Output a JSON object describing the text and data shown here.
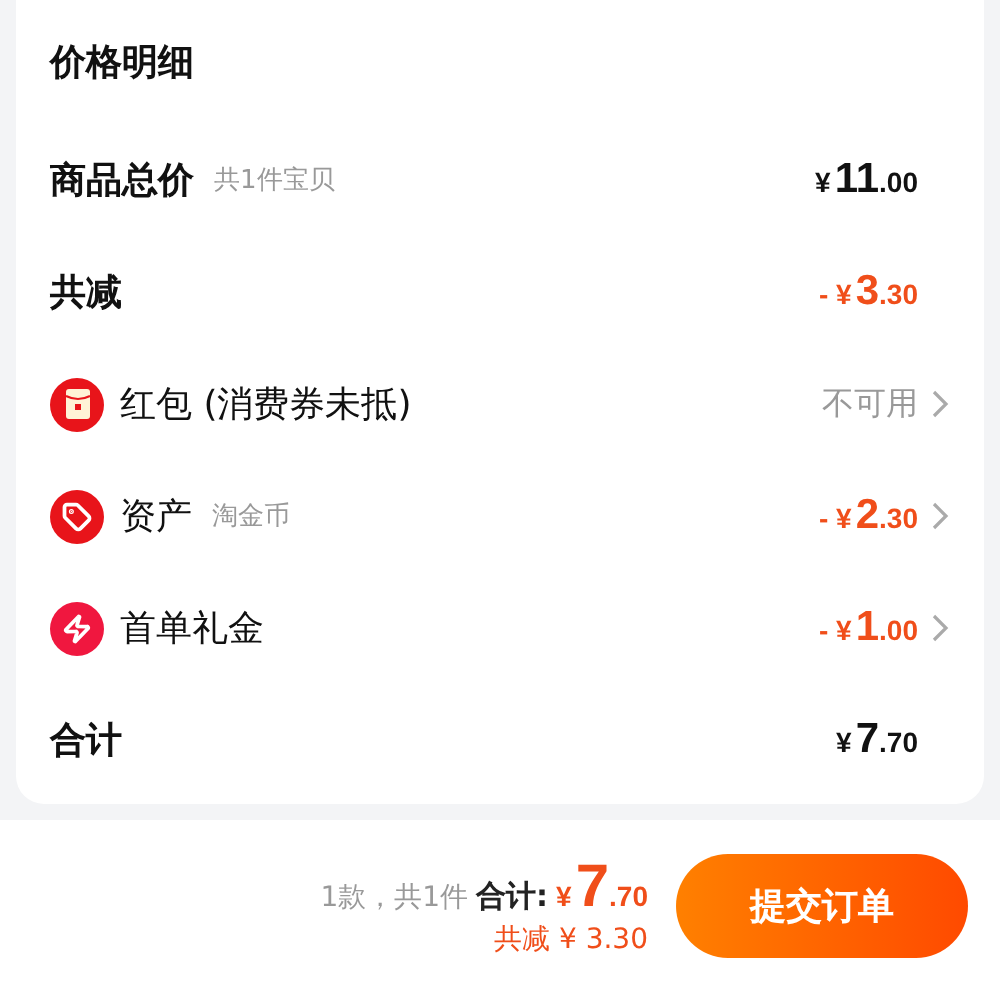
{
  "title": "价格明细",
  "rows": [
    {
      "kind": "summary",
      "label": "商品总价",
      "note": "共1件宝贝",
      "value": {
        "kind": "price",
        "sign": "¥",
        "integer": "11",
        "decimals": ".00"
      },
      "chevron": false
    },
    {
      "kind": "summary",
      "label": "共减",
      "value": {
        "kind": "deduction",
        "sign": "- ¥",
        "integer": "3",
        "decimals": ".30"
      },
      "chevron": false
    },
    {
      "kind": "packet",
      "label": "红包 (消费券未抵)",
      "value": {
        "kind": "text",
        "text": "不可用"
      },
      "chevron": true
    },
    {
      "kind": "asset",
      "label": "资产",
      "note": "淘金币",
      "value": {
        "kind": "deduction",
        "sign": "- ¥",
        "integer": "2",
        "decimals": ".30"
      },
      "chevron": true
    },
    {
      "kind": "gift",
      "label": "首单礼金",
      "value": {
        "kind": "deduction",
        "sign": "- ¥",
        "integer": "1",
        "decimals": ".00"
      },
      "chevron": true
    },
    {
      "kind": "summary",
      "label": "合计",
      "value": {
        "kind": "price",
        "sign": "¥",
        "integer": "7",
        "decimals": ".70"
      },
      "chevron": false
    }
  ],
  "footer": {
    "count": "1款，共1件",
    "total_label": "合计:",
    "total": {
      "sign": "¥",
      "integer": "7",
      "decimals": ".70"
    },
    "saved": "共减 ¥ 3.30",
    "submit": "提交订单"
  }
}
